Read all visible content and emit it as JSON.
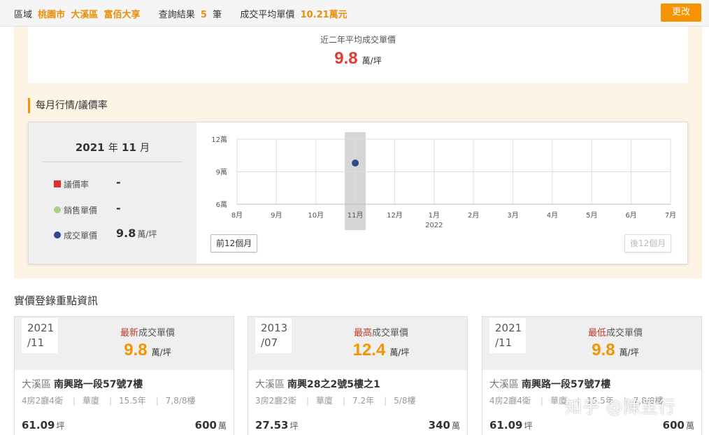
{
  "topbar": {
    "region_label": "區域",
    "city": "桃園市",
    "district": "大溪區",
    "community": "富佰大享",
    "results_label": "查詢結果",
    "results_count": "5",
    "results_unit": "筆",
    "avg_label": "成交平均單價",
    "avg_value": "10.21萬元",
    "change_button": "更改"
  },
  "summary": {
    "title": "近二年平均成交單價",
    "value": "9.8",
    "unit": "萬/坪"
  },
  "monthly": {
    "section_title": "每月行情/議價率",
    "selected_year": "2021",
    "year_suffix": "年",
    "selected_month": "11",
    "month_suffix": "月",
    "legend": [
      {
        "label": "議價率",
        "value": "-",
        "unit": "",
        "color": "#e0302a",
        "shape": "square"
      },
      {
        "label": "銷售單價",
        "value": "-",
        "unit": "",
        "color": "#a8d08d",
        "shape": "circle"
      },
      {
        "label": "成交單價",
        "value": "9.8",
        "unit": "萬/坪",
        "color": "#2f4a8a",
        "shape": "circle"
      }
    ],
    "prev_button": "前12個月",
    "next_button": "後12個月"
  },
  "chart_data": {
    "type": "scatter",
    "categories": [
      "8月",
      "9月",
      "10月",
      "11月",
      "12月",
      "1月",
      "2月",
      "3月",
      "4月",
      "5月",
      "6月",
      "7月"
    ],
    "year_label": {
      "index": 5,
      "text": "2022"
    },
    "y_ticks": [
      "6萬",
      "9萬",
      "12萬"
    ],
    "ylim": [
      6,
      12
    ],
    "grid": true,
    "highlight_index": 3,
    "series": [
      {
        "name": "成交單價",
        "color": "#2f4a8a",
        "points": [
          {
            "index": 3,
            "value": 9.8
          }
        ]
      }
    ]
  },
  "key_info": {
    "title": "實價登錄重點資訊",
    "cards": [
      {
        "year": "2021",
        "month": "/11",
        "type_em": "最新",
        "type_rest": "成交單價",
        "price": "9.8",
        "unit": "萬/坪",
        "district": "大溪區",
        "road": "南興路一段57號7樓",
        "layout": "4房2廳4衛",
        "building": "華廈",
        "age": "15.5年",
        "floor": "7,8/8樓",
        "area": "61.09",
        "area_unit": "坪",
        "total": "600",
        "total_unit": "萬"
      },
      {
        "year": "2013",
        "month": "/07",
        "type_em": "最高",
        "type_rest": "成交單價",
        "price": "12.4",
        "unit": "萬/坪",
        "district": "大溪區",
        "road": "南興28之2號5樓之1",
        "layout": "3房2廳2衛",
        "building": "華廈",
        "age": "7.2年",
        "floor": "5/8樓",
        "area": "27.53",
        "area_unit": "坪",
        "total": "340",
        "total_unit": "萬"
      },
      {
        "year": "2021",
        "month": "/11",
        "type_em": "最低",
        "type_rest": "成交單價",
        "price": "9.8",
        "unit": "萬/坪",
        "district": "大溪區",
        "road": "南興路一段57號7樓",
        "layout": "4房2廳4衛",
        "building": "華廈",
        "age": "15.5年",
        "floor": "7,8/8樓",
        "area": "61.09",
        "area_unit": "坪",
        "total": "600",
        "total_unit": "萬"
      }
    ]
  },
  "watermark": "知乎 @陳昱行"
}
